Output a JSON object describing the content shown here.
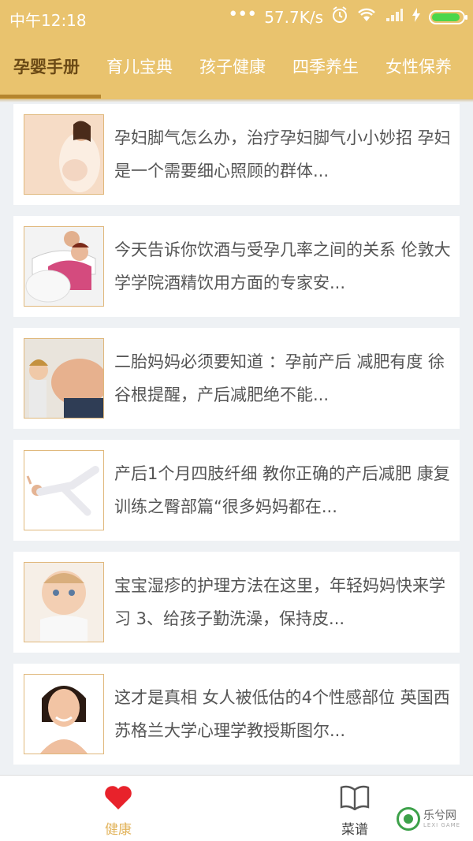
{
  "status_bar": {
    "time": "中午12:18",
    "network_speed": "57.7K/s"
  },
  "tabs": [
    {
      "label": "孕婴手册",
      "active": true
    },
    {
      "label": "育儿宝典",
      "active": false
    },
    {
      "label": "孩子健康",
      "active": false
    },
    {
      "label": "四季养生",
      "active": false
    },
    {
      "label": "女性保养",
      "active": false
    }
  ],
  "articles": [
    {
      "text": "孕妇脚气怎么办，治疗孕妇脚气小小妙招 孕妇是一个需要细心照顾的群体...",
      "thumb": "pregnant-woman-photo"
    },
    {
      "text": "今天告诉你饮酒与受孕几率之间的关系 伦敦大学学院酒精饮用方面的专家安...",
      "thumb": "couple-photo"
    },
    {
      "text": "二胎妈妈必须要知道 ：孕前产后 减肥有度 徐谷根提醒，产后减肥绝不能...",
      "thumb": "child-and-belly-photo"
    },
    {
      "text": "产后1个月四肢纤细 教你正确的产后减肥 康复训练之臀部篇“很多妈妈都在...",
      "thumb": "exercise-photo"
    },
    {
      "text": "宝宝湿疹的护理方法在这里，年轻妈妈快来学习 3、给孩子勤洗澡，保持皮...",
      "thumb": "baby-photo"
    },
    {
      "text": "这才是真相 女人被低估的4个性感部位 英国西苏格兰大学心理学教授斯图尔...",
      "thumb": "woman-portrait-photo"
    }
  ],
  "bottom_nav": {
    "health_label": "健康",
    "recipes_label": "菜谱"
  },
  "watermark": {
    "text": "乐兮网",
    "sub": "LEXI GAME"
  },
  "colors": {
    "header": "#e9c36e",
    "tab_active": "#6b4a16",
    "indicator": "#b5852e",
    "heart": "#e8222b",
    "nav_active_label": "#e2b45c"
  }
}
